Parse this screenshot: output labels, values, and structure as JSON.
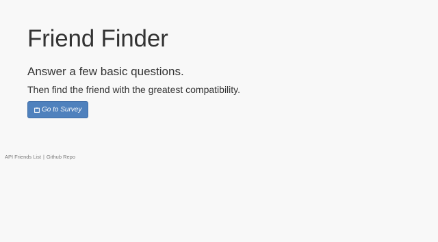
{
  "hero": {
    "title": "Friend Finder",
    "lead": "Answer a few basic questions.",
    "subtext": "Then find the friend with the greatest compatibility.",
    "button": {
      "label": "Go to Survey",
      "icon": "clipboard-icon",
      "color": "#4f81bd"
    }
  },
  "footer": {
    "links": [
      {
        "label": "API Friends List"
      },
      {
        "label": "Github Repo"
      }
    ],
    "separator": "|"
  },
  "colors": {
    "background": "#f8f8f8",
    "text": "#333333",
    "button": "#4f81bd"
  }
}
